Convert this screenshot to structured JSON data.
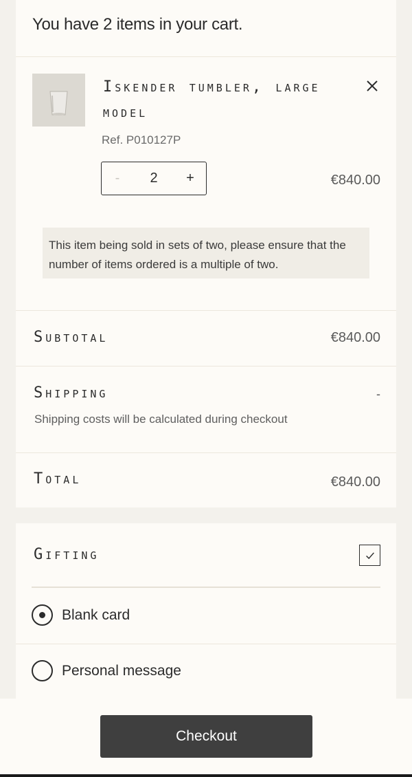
{
  "cart": {
    "header": "You have 2 items in your cart.",
    "item": {
      "name": "Iskender tumbler, large model",
      "ref": "Ref. P010127P",
      "quantity": "2",
      "qty_minus": "-",
      "qty_plus": "+",
      "price": "€840.00",
      "notice": "This item being sold in sets of two, please ensure that the number of items ordered is a multiple of two.",
      "icons": {
        "remove": "close-icon",
        "thumbnail": "glass-tumbler-image"
      }
    },
    "summary": {
      "subtotal_label": "Subtotal",
      "subtotal_value": "€840.00",
      "shipping_label": "Shipping",
      "shipping_value": "-",
      "shipping_note": "Shipping costs will be calculated during checkout",
      "total_label": "Total",
      "total_value": "€840.00"
    }
  },
  "gifting": {
    "label": "Gifting",
    "checked": true,
    "options": [
      {
        "label": "Blank card",
        "selected": true
      },
      {
        "label": "Personal message",
        "selected": false
      }
    ]
  },
  "footer": {
    "checkout_label": "Checkout"
  },
  "colors": {
    "page_bg": "#f3f1ec",
    "panel_bg": "#fdfbf7",
    "text": "#2b2b2b",
    "button_bg": "#3f3f3f",
    "notice_bg": "#f0ede6"
  }
}
